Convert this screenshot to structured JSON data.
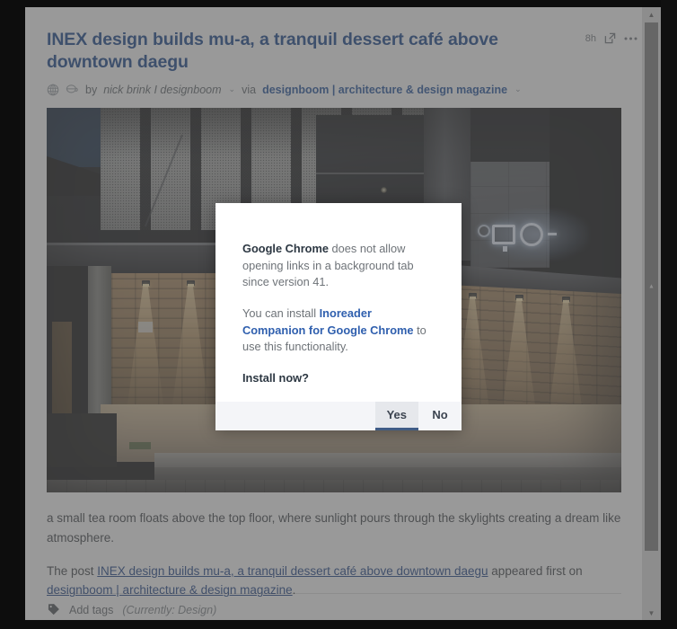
{
  "article": {
    "title": "INEX design builds mu-a, a tranquil dessert café above downtown daegu",
    "time_ago": "8h",
    "open_icon": "external-link-icon",
    "more_icon": "ellipsis-icon",
    "globe_icon": "globe-icon",
    "mug_icon": "coffee-mug-icon",
    "by_label": "by",
    "author": "nick brink I designboom",
    "author_caret": "⌄",
    "via_label": "via",
    "source": "designboom | architecture & design magazine",
    "source_caret": "⌄",
    "image_alt": "night photograph of mu-a dessert café entrance, perforated metal facade and illuminated brick walls",
    "paragraph_1": "a small tea room floats above the top floor, where sunlight pours through the skylights creating a dream like atmosphere.",
    "paragraph_2_prefix": "The post ",
    "paragraph_2_link": "INEX design builds mu-a, a tranquil dessert café above downtown daegu",
    "paragraph_2_middle": " appeared first on ",
    "paragraph_2_link2": "designboom | architecture & design magazine",
    "paragraph_2_suffix": "."
  },
  "tags": {
    "icon": "tag-icon",
    "add_label": "Add tags",
    "current_label": "(Currently: Design)"
  },
  "dialog": {
    "line1_bold": "Google Chrome",
    "line1_rest": " does not allow opening links in a background tab since version 41.",
    "line2_prefix": "You can install ",
    "line2_link": "Inoreader Companion for Google Chrome",
    "line2_suffix": " to use this functionality.",
    "prompt": "Install now?",
    "yes_label": "Yes",
    "no_label": "No"
  },
  "scrollbar": {
    "up_arrow": "▲",
    "down_arrow": "▼",
    "grip": "▲"
  },
  "colors": {
    "title_blue": "#12408a",
    "link_blue": "#1a3f86",
    "dialog_link": "#2f5fae",
    "dialog_text": "#6e7378",
    "accent_underline": "#3f5c86",
    "dim_overlay": "rgba(90,90,90,0.62)"
  }
}
